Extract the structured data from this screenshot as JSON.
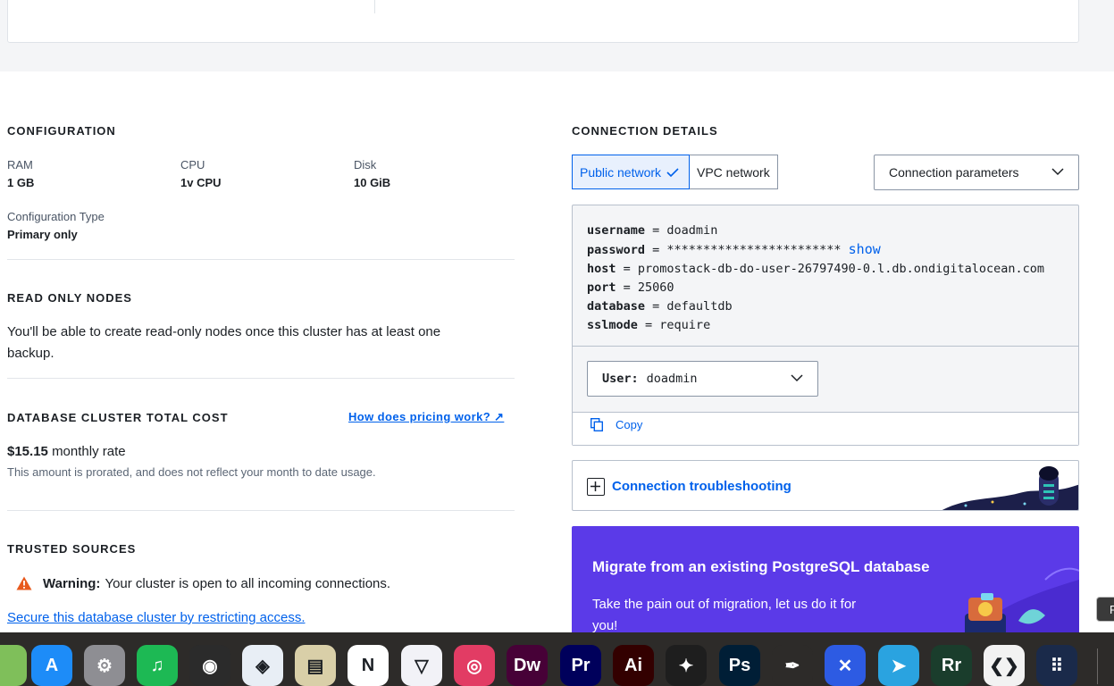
{
  "configuration": {
    "title": "CONFIGURATION",
    "ram": {
      "label": "RAM",
      "value": "1 GB"
    },
    "cpu": {
      "label": "CPU",
      "value": "1v CPU"
    },
    "disk": {
      "label": "Disk",
      "value": "10 GiB"
    },
    "config_type": {
      "label": "Configuration Type",
      "value": "Primary only"
    }
  },
  "read_only": {
    "title": "READ ONLY NODES",
    "text": "You'll be able to create read-only nodes once this cluster has at least one backup."
  },
  "cost": {
    "title": "DATABASE CLUSTER TOTAL COST",
    "pricing_link": "How does pricing work? ↗",
    "amount": "$15.15",
    "rate_label": "monthly rate",
    "note": "This amount is prorated, and does not reflect your month to date usage."
  },
  "trusted": {
    "title": "TRUSTED SOURCES",
    "warning_bold": "Warning:",
    "warning_text": "Your cluster is open to all incoming connections.",
    "link": "Secure this database cluster by restricting access."
  },
  "connection": {
    "title": "CONNECTION DETAILS",
    "tabs": [
      {
        "label": "Public network",
        "active": true
      },
      {
        "label": "VPC network",
        "active": false
      }
    ],
    "format_select": "Connection parameters",
    "params": [
      {
        "key": "username",
        "value": "doadmin"
      },
      {
        "key": "password",
        "value": "************************"
      },
      {
        "key": "host",
        "value": "promostack-db-do-user-26797490-0.l.db.ondigitalocean.com"
      },
      {
        "key": "port",
        "value": "25060"
      },
      {
        "key": "database",
        "value": "defaultdb"
      },
      {
        "key": "sslmode",
        "value": "require"
      }
    ],
    "show_label": "show",
    "user_label": "User:",
    "user_value": "doadmin",
    "copy_label": "Copy",
    "troubleshoot_label": "Connection troubleshooting"
  },
  "promo": {
    "title": "Migrate from an existing PostgreSQL database",
    "text": "Take the pain out of migration, let us do it for you!"
  },
  "edge_button": "F",
  "dock": [
    {
      "name": "photos",
      "label": "",
      "color": "#7fbf5a"
    },
    {
      "name": "app-store",
      "label": "A",
      "color": "#1d8cf8"
    },
    {
      "name": "system-settings",
      "label": "⚙",
      "color": "#8e8e93"
    },
    {
      "name": "spotify",
      "label": "♫",
      "color": "#1db954"
    },
    {
      "name": "blender",
      "label": "◉",
      "color": "#2b2b2b"
    },
    {
      "name": "sketchup",
      "label": "◈",
      "color": "#e8eef5"
    },
    {
      "name": "preview",
      "label": "▤",
      "color": "#d9cfa8"
    },
    {
      "name": "notion",
      "label": "N",
      "color": "#ffffff"
    },
    {
      "name": "proton-vpn",
      "label": "▽",
      "color": "#f2f2f7"
    },
    {
      "name": "creative-cloud",
      "label": "◎",
      "color": "#e23c64"
    },
    {
      "name": "dreamweaver",
      "label": "Dw",
      "color": "#470137"
    },
    {
      "name": "premiere-pro",
      "label": "Pr",
      "color": "#00005b"
    },
    {
      "name": "illustrator",
      "label": "Ai",
      "color": "#330000"
    },
    {
      "name": "figma",
      "label": "✦",
      "color": "#1e1e1e"
    },
    {
      "name": "photoshop",
      "label": "Ps",
      "color": "#001e36"
    },
    {
      "name": "inkscape",
      "label": "✒",
      "color": "#2d2b29"
    },
    {
      "name": "xmind",
      "label": "✕",
      "color": "#2d5be3"
    },
    {
      "name": "telegram",
      "label": "➤",
      "color": "#2aa3e0"
    },
    {
      "name": "rr-app",
      "label": "Rr",
      "color": "#1a3d2c"
    },
    {
      "name": "vscode",
      "label": "❮❯",
      "color": "#f2f2f2"
    },
    {
      "name": "launchpad",
      "label": "⠿",
      "color": "#1a2a4a"
    }
  ]
}
